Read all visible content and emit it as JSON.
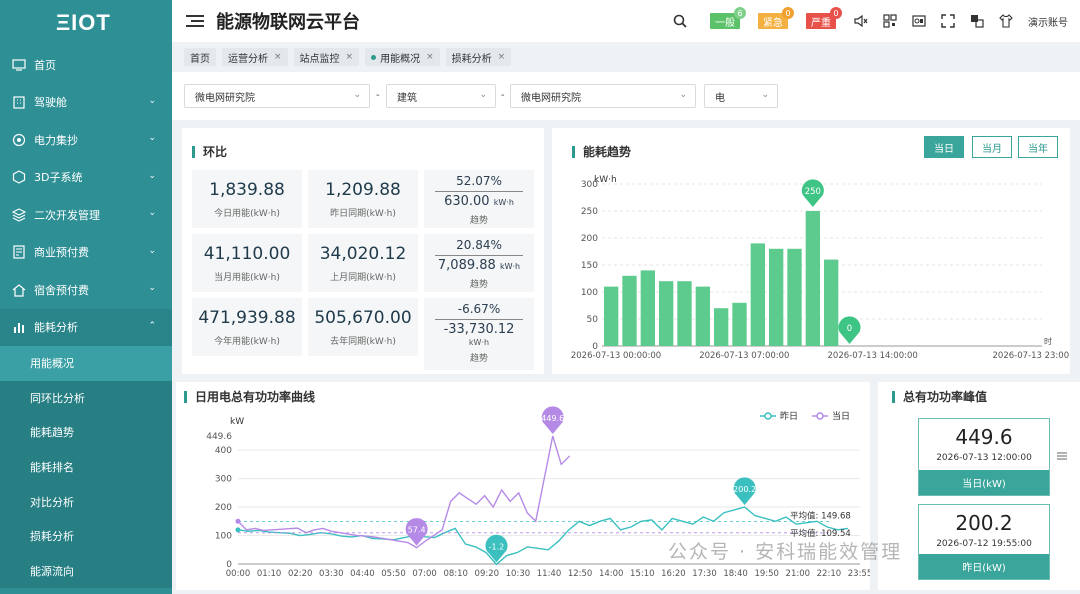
{
  "sidebar": {
    "logo": "ΞIOT",
    "items": [
      {
        "label": "首页",
        "icon": "monitor-icon",
        "chev": ""
      },
      {
        "label": "驾驶舱",
        "icon": "building-icon",
        "chev": "⌄"
      },
      {
        "label": "电力集抄",
        "icon": "meter-icon",
        "chev": "⌄"
      },
      {
        "label": "3D子系统",
        "icon": "cube-icon",
        "chev": "⌄"
      },
      {
        "label": "二次开发管理",
        "icon": "layers-icon",
        "chev": "⌄"
      },
      {
        "label": "商业预付费",
        "icon": "receipt-icon",
        "chev": "⌄"
      },
      {
        "label": "宿舍预付费",
        "icon": "home-icon",
        "chev": "⌄"
      },
      {
        "label": "能耗分析",
        "icon": "barchart-icon",
        "chev": "⌃"
      }
    ],
    "sub_items": [
      "用能概况",
      "同环比分析",
      "能耗趋势",
      "能耗排名",
      "对比分析",
      "损耗分析",
      "能源流向"
    ]
  },
  "header": {
    "title": "能源物联网云平台",
    "badges": [
      {
        "label": "一般",
        "count": "6",
        "color": "#5cc26a",
        "count_color": "#7fd08a"
      },
      {
        "label": "紧急",
        "count": "0",
        "color": "#f5b042",
        "count_color": "#f0a030"
      },
      {
        "label": "严重",
        "count": "0",
        "color": "#e8514a",
        "count_color": "#e8514a"
      }
    ],
    "user": "演示账号"
  },
  "tabs": [
    {
      "label": "首页",
      "close": "",
      "dot": false
    },
    {
      "label": "运营分析",
      "close": "×",
      "dot": false
    },
    {
      "label": "站点监控",
      "close": "×",
      "dot": false
    },
    {
      "label": "用能概况",
      "close": "×",
      "dot": true
    },
    {
      "label": "损耗分析",
      "close": "×",
      "dot": false
    }
  ],
  "filters": {
    "site1": "微电网研究院",
    "dash": "-",
    "type": "建筑",
    "site2": "微电网研究院",
    "energy": "电"
  },
  "huanbi": {
    "title": "环比",
    "cards": [
      {
        "value": "1,839.88",
        "label": "今日用能(kW·h)"
      },
      {
        "value": "1,209.88",
        "label": "昨日同期(kW·h)"
      },
      {
        "value": "41,110.00",
        "label": "当月用能(kW·h)"
      },
      {
        "value": "34,020.12",
        "label": "上月同期(kW·h)"
      },
      {
        "value": "471,939.88",
        "label": "今年用能(kW·h)"
      },
      {
        "value": "505,670.00",
        "label": "去年同期(kW·h)"
      }
    ],
    "trends": [
      {
        "pct": "52.07%",
        "diff": "630.00",
        "unit": "kW·h",
        "sub": "",
        "label": "趋势"
      },
      {
        "pct": "20.84%",
        "diff": "7,089.88",
        "unit": "kW·h",
        "sub": "",
        "label": "趋势"
      },
      {
        "pct": "-6.67%",
        "diff": "-33,730.12",
        "unit": "",
        "sub": "kW·h",
        "label": "趋势"
      }
    ]
  },
  "trend_panel": {
    "title": "能耗趋势",
    "ranges": [
      "当日",
      "当月",
      "当年"
    ],
    "active_range": 0
  },
  "curve_panel": {
    "title": "日用电总有功功率曲线"
  },
  "peak_panel": {
    "title": "总有功功率峰值",
    "today": {
      "value": "449.6",
      "time": "2026-07-13 12:00:00",
      "label": "当日(kW)"
    },
    "yesterday": {
      "value": "200.2",
      "time": "2026-07-12 19:55:00",
      "label": "昨日(kW)"
    }
  },
  "watermark": "公众号 · 安科瑞能效管理",
  "chart_data": [
    {
      "type": "bar",
      "ylabel": "kW·h",
      "ylim": [
        0,
        300
      ],
      "yticks": [
        0,
        50,
        100,
        150,
        200,
        250,
        300
      ],
      "values": [
        110,
        130,
        140,
        120,
        120,
        110,
        70,
        80,
        190,
        180,
        180,
        250,
        160,
        0
      ],
      "xtick_labels": [
        "2026-07-13 00:00:00",
        "2026-07-13 07:00:00",
        "2026-07-13 14:00:00",
        "2026-07-13 23:00:00"
      ],
      "xtick_index": [
        0,
        7,
        14,
        23
      ],
      "n_slots": 24,
      "x_unit": "时",
      "max_label": "250",
      "min_label": "0",
      "color": "#5ecb8e"
    },
    {
      "type": "line",
      "ylabel": "kW",
      "ylim": [
        0,
        449.6
      ],
      "yticks": [
        0,
        100,
        200,
        300,
        400
      ],
      "ytop_label": "449.6",
      "xtick_labels": [
        "00:00",
        "01:10",
        "02:20",
        "03:30",
        "04:40",
        "05:50",
        "07:00",
        "08:10",
        "09:20",
        "10:30",
        "11:40",
        "12:50",
        "14:00",
        "15:10",
        "16:20",
        "17:30",
        "18:40",
        "19:50",
        "21:00",
        "22:10",
        "23:55"
      ],
      "series": [
        {
          "name": "昨日",
          "color": "#3bbfbf",
          "max_label": "200.2",
          "min_label": "-1.2",
          "avg_label": "平均值: 149.68",
          "avg": 149.68,
          "values": [
            120,
            115,
            118,
            112,
            110,
            108,
            100,
            104,
            110,
            106,
            98,
            95,
            100,
            90,
            88,
            85,
            92,
            100,
            96,
            93,
            110,
            125,
            70,
            60,
            40,
            -1.2,
            30,
            40,
            60,
            55,
            50,
            80,
            120,
            150,
            135,
            150,
            160,
            120,
            130,
            150,
            155,
            120,
            160,
            150,
            140,
            165,
            150,
            180,
            190,
            200.2,
            170,
            160,
            150,
            165,
            140,
            145,
            150,
            130,
            120,
            125
          ]
        },
        {
          "name": "当日",
          "color": "#b58ae6",
          "max_label": "449.6",
          "min_label": "57.4",
          "avg_label": "平均值: 109.54",
          "avg": 109.54,
          "values": [
            150,
            120,
            125,
            118,
            120,
            122,
            124,
            126,
            110,
            120,
            125,
            115,
            110,
            105,
            100,
            98,
            95,
            90,
            85,
            80,
            75,
            57.4,
            80,
            100,
            120,
            220,
            250,
            230,
            210,
            240,
            200,
            260,
            220,
            250,
            180,
            150,
            300,
            449.6,
            350,
            380
          ]
        }
      ]
    }
  ]
}
